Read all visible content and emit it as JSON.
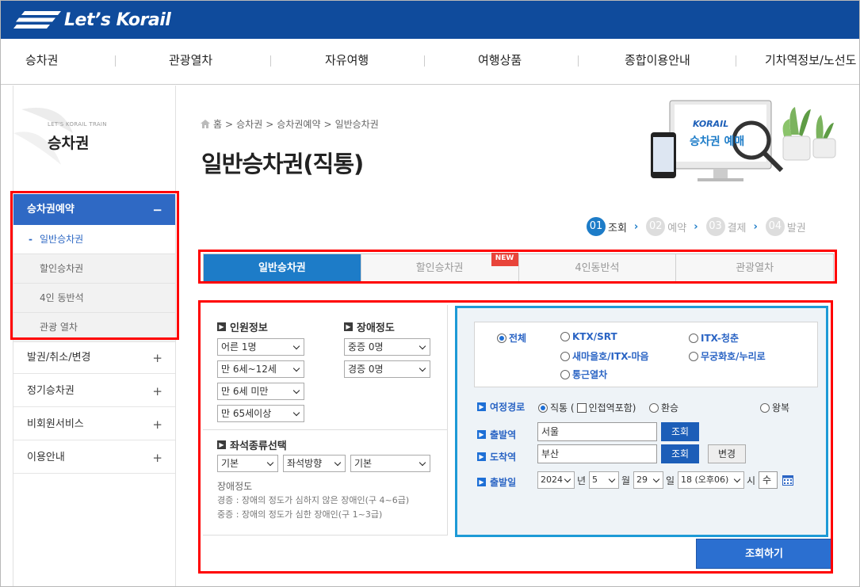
{
  "header": {
    "logo_text": "Let’s Korail",
    "bg_color": "#0f4b9c"
  },
  "gnb": {
    "items": [
      "승차권",
      "관광열차",
      "자유여행",
      "여행상품",
      "종합이용안내",
      "기차역정보/노선도"
    ]
  },
  "lnb": {
    "small_caption": "LET'S KORAIL TRAIN",
    "title": "승차권",
    "menus": [
      {
        "label": "승차권예약",
        "sign": "−"
      },
      {
        "label": "발권/취소/변경",
        "sign": "+"
      },
      {
        "label": "정기승차권",
        "sign": "+"
      },
      {
        "label": "비회원서비스",
        "sign": "+"
      },
      {
        "label": "이용안내",
        "sign": "+"
      }
    ],
    "submenus": [
      {
        "label": "일반승차권",
        "dash": "-"
      },
      {
        "label": "할인승차권"
      },
      {
        "label": "4인 동반석"
      },
      {
        "label": "관광 열차"
      }
    ]
  },
  "breadcrumb": {
    "home": "홈",
    "sep": ">",
    "items": [
      "승차권",
      "승차권예약",
      "일반승차권"
    ]
  },
  "page_title": "일반승차권(직통)",
  "hero": {
    "logo": "KORAIL",
    "screen_text": "승차권 예매"
  },
  "steps": [
    {
      "num": "01",
      "label": "조회"
    },
    {
      "num": "02",
      "label": "예약"
    },
    {
      "num": "03",
      "label": "결제"
    },
    {
      "num": "04",
      "label": "발권"
    }
  ],
  "tabs": [
    {
      "label": "일반승차권"
    },
    {
      "label": "할인승차권"
    },
    {
      "label": "4인동반석"
    },
    {
      "label": "관광열차"
    }
  ],
  "new_badge": "NEW",
  "passenger": {
    "heading": "인원정보",
    "selects": [
      "어른 1명",
      "만 6세~12세",
      "만 6세 미만",
      "만 65세이상"
    ]
  },
  "disability": {
    "heading": "장애정도",
    "selects": [
      "중증 0명",
      "경증 0명"
    ]
  },
  "seat": {
    "heading": "좌석종류선택",
    "selects": [
      "기본",
      "좌석방향",
      "기본"
    ]
  },
  "notes": {
    "title": "장애정도",
    "line1": "경증 : 장애의 정도가 심하지 않은 장애인(구 4~6급)",
    "line2": "중증 : 장애의 정도가 심한 장애인(구 1~3급)"
  },
  "train_types": [
    "전체",
    "KTX/SRT",
    "ITX-청춘",
    "새마을호/ITX-마음",
    "무궁화호/누리로",
    "통근열차"
  ],
  "route": {
    "label": "여정경로",
    "direct": "직통 (",
    "include": "인접역포함)",
    "transfer": "환승",
    "round": "왕복"
  },
  "departure": {
    "label": "출발역",
    "value": "서울",
    "btn": "조회"
  },
  "arrival": {
    "label": "도착역",
    "value": "부산",
    "btn": "조회",
    "change": "변경"
  },
  "date": {
    "label": "출발일",
    "year": "2024",
    "year_unit": "년",
    "month": "5",
    "month_unit": "월",
    "day": "29",
    "day_unit": "일",
    "hour": "18 (오후06)",
    "hour_unit": "시",
    "weekday": "수"
  },
  "search_button": "조회하기",
  "colors": {
    "accent": "#1d7cc8",
    "highlight_red": "#ff0000",
    "nav_blue": "#2f69c4"
  }
}
